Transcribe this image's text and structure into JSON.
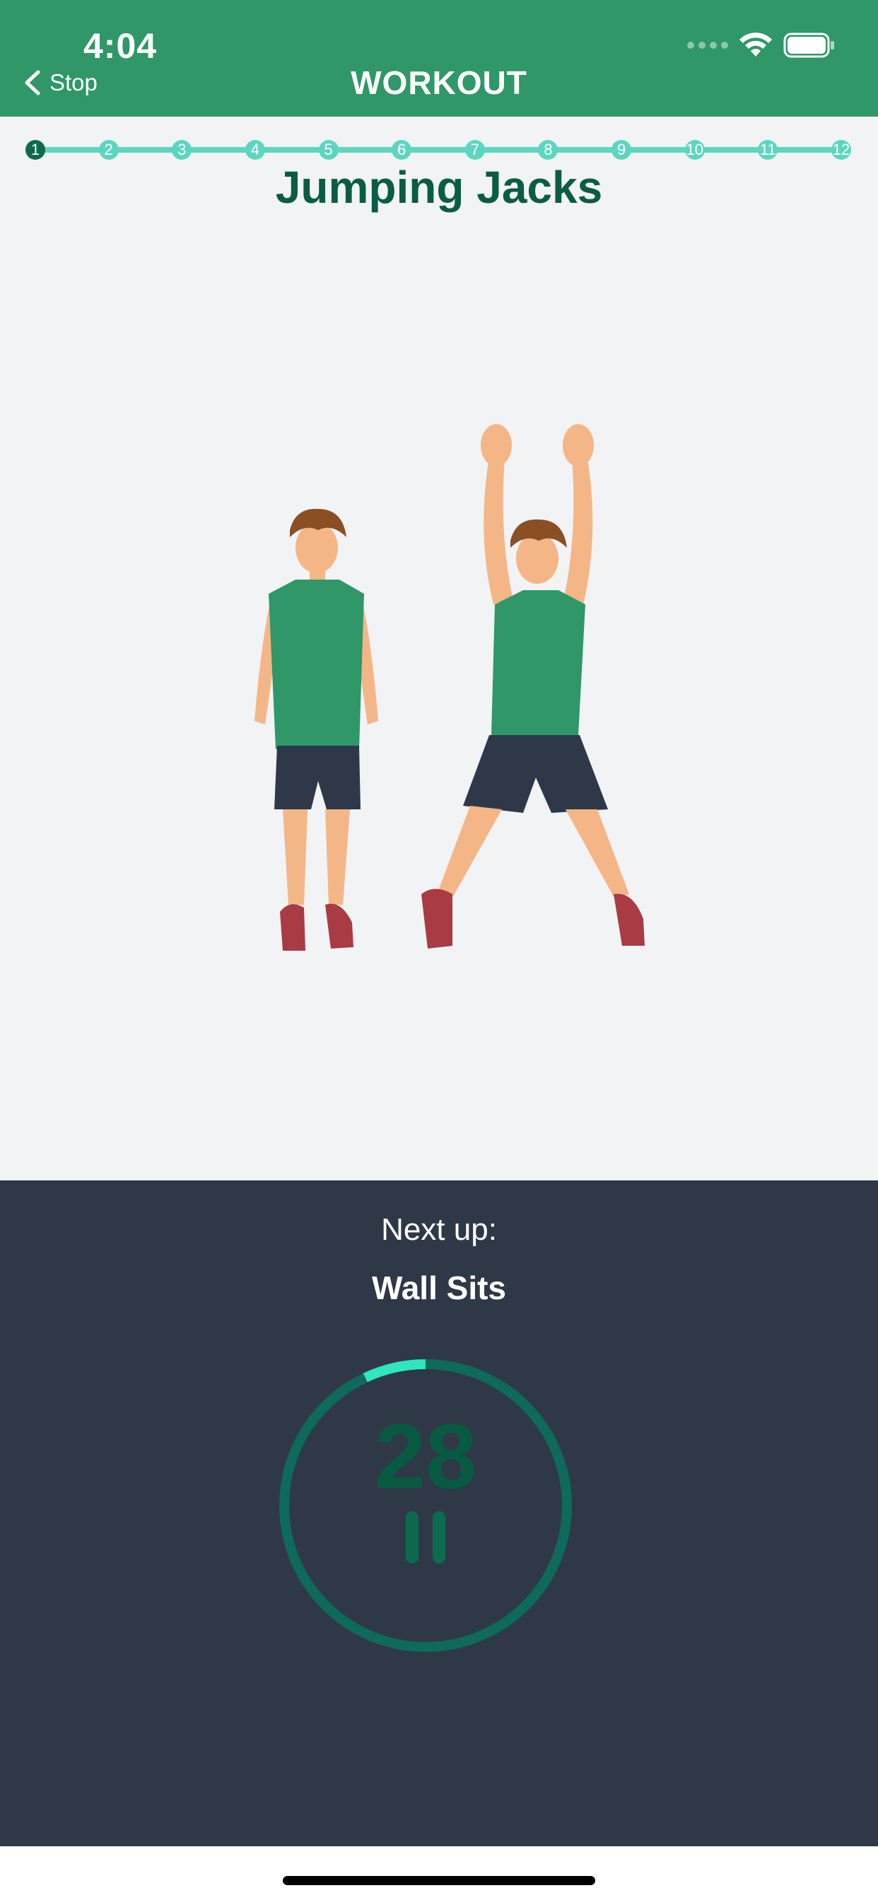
{
  "status_bar": {
    "time": "4:04"
  },
  "nav": {
    "back_label": "Stop",
    "title": "WORKOUT"
  },
  "progress": {
    "steps": [
      "1",
      "2",
      "3",
      "4",
      "5",
      "6",
      "7",
      "8",
      "9",
      "10",
      "11",
      "12"
    ],
    "current": 1
  },
  "exercise": {
    "name": "Jumping Jacks"
  },
  "next": {
    "label": "Next up:",
    "name": "Wall Sits"
  },
  "timer": {
    "seconds": "28",
    "progress_fraction": 0.07
  },
  "colors": {
    "header": "#2f9768",
    "accent": "#5cd6c0",
    "dark_panel": "#2f3847",
    "title_green": "#0b5c44",
    "ring": "#0e6a5a",
    "ring_progress": "#2ee6c0"
  },
  "icons": {
    "back": "chevron-left-icon",
    "wifi": "wifi-icon",
    "battery": "battery-icon",
    "pause": "pause-icon"
  }
}
